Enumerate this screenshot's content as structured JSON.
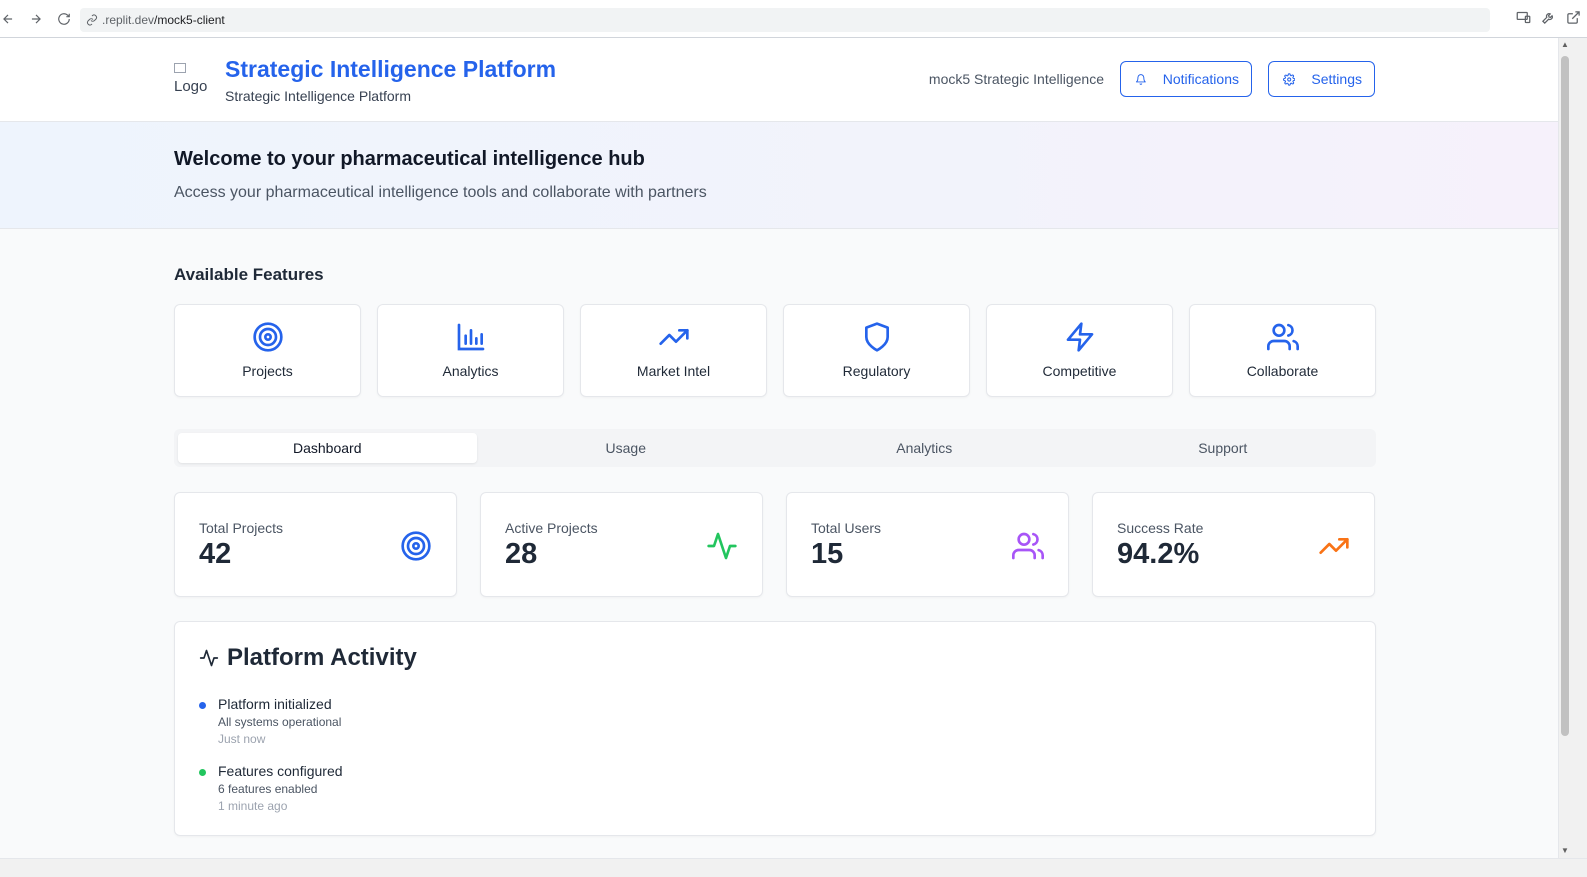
{
  "browser": {
    "url_host": ".replit.dev",
    "url_path": "/mock5-client"
  },
  "header": {
    "logo_alt": "Logo",
    "title": "Strategic Intelligence Platform",
    "subtitle": "Strategic Intelligence Platform",
    "org_name": "mock5 Strategic Intelligence",
    "notifications_label": "Notifications",
    "settings_label": "Settings"
  },
  "welcome": {
    "heading": "Welcome to your pharmaceutical intelligence hub",
    "description": "Access your pharmaceutical intelligence tools and collaborate with partners"
  },
  "features": {
    "title": "Available Features",
    "items": [
      {
        "label": "Projects",
        "icon": "target-icon"
      },
      {
        "label": "Analytics",
        "icon": "bar-chart-icon"
      },
      {
        "label": "Market Intel",
        "icon": "trending-up-icon"
      },
      {
        "label": "Regulatory",
        "icon": "shield-icon"
      },
      {
        "label": "Competitive",
        "icon": "lightning-icon"
      },
      {
        "label": "Collaborate",
        "icon": "users-icon"
      }
    ]
  },
  "tabs": {
    "items": [
      {
        "label": "Dashboard",
        "active": true
      },
      {
        "label": "Usage",
        "active": false
      },
      {
        "label": "Analytics",
        "active": false
      },
      {
        "label": "Support",
        "active": false
      }
    ]
  },
  "stats": [
    {
      "label": "Total Projects",
      "value": "42",
      "icon": "target-icon",
      "color": "#2563eb"
    },
    {
      "label": "Active Projects",
      "value": "28",
      "icon": "activity-icon",
      "color": "#22c55e"
    },
    {
      "label": "Total Users",
      "value": "15",
      "icon": "users-icon",
      "color": "#a855f7"
    },
    {
      "label": "Success Rate",
      "value": "94.2%",
      "icon": "trending-up-icon",
      "color": "#f97316"
    }
  ],
  "activity": {
    "title": "Platform Activity",
    "items": [
      {
        "title": "Platform initialized",
        "description": "All systems operational",
        "time": "Just now",
        "dot_color": "#2563eb"
      },
      {
        "title": "Features configured",
        "description": "6 features enabled",
        "time": "1 minute ago",
        "dot_color": "#22c55e"
      }
    ]
  },
  "colors": {
    "primary": "#2563eb"
  }
}
